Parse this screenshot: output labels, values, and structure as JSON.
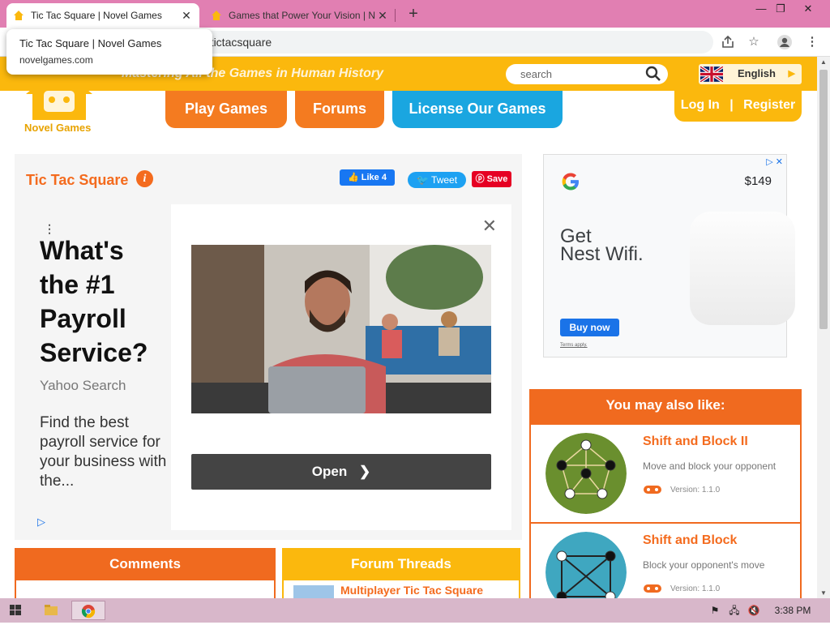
{
  "browser": {
    "tabs": [
      {
        "title": "Tic Tac Square | Novel Games",
        "active": true
      },
      {
        "title": "Games that Power Your Vision | N",
        "active": false
      }
    ],
    "address": "n/tictacsquare",
    "hover_card": {
      "title": "Tic Tac Square | Novel Games",
      "url": "novelgames.com"
    }
  },
  "site": {
    "logo_text": "Novel Games",
    "tagline": "Mastering All the Games in Human History",
    "search_placeholder": "search",
    "language": "English",
    "nav": {
      "play": "Play Games",
      "forums": "Forums",
      "license": "License Our Games",
      "login": "Log In",
      "sep": "|",
      "register": "Register"
    }
  },
  "game": {
    "title": "Tic Tac Square",
    "fb_like": "Like 4",
    "tweet": "Tweet",
    "save": "Save"
  },
  "ad_left": {
    "headline": "What's the #1 Payroll Service?",
    "source": "Yahoo Search",
    "body": "Find the best payroll service for your business with the...",
    "cta": "Open"
  },
  "ad_right": {
    "price": "$149",
    "headline_line1": "Get",
    "headline_line2": "Nest Wifi.",
    "cta": "Buy now",
    "terms": "Terms apply."
  },
  "also_like": {
    "heading": "You may also like:",
    "items": [
      {
        "title": "Shift and Block II",
        "desc": "Move and block your opponent",
        "version": "Version: 1.1.0",
        "color": "#6a8f2e"
      },
      {
        "title": "Shift and Block",
        "desc": "Block your opponent's move",
        "version": "Version: 1.1.0",
        "color": "#3fa7c0"
      }
    ]
  },
  "comments": {
    "heading": "Comments"
  },
  "forum": {
    "heading": "Forum Threads",
    "first_thread": "Multiplayer Tic Tac Square"
  },
  "taskbar": {
    "time": "3:38 PM"
  },
  "colors": {
    "orange": "#f47b20",
    "yellow": "#fbb80d",
    "blue": "#1aa6e0",
    "tab_bar": "#e17fb2"
  }
}
